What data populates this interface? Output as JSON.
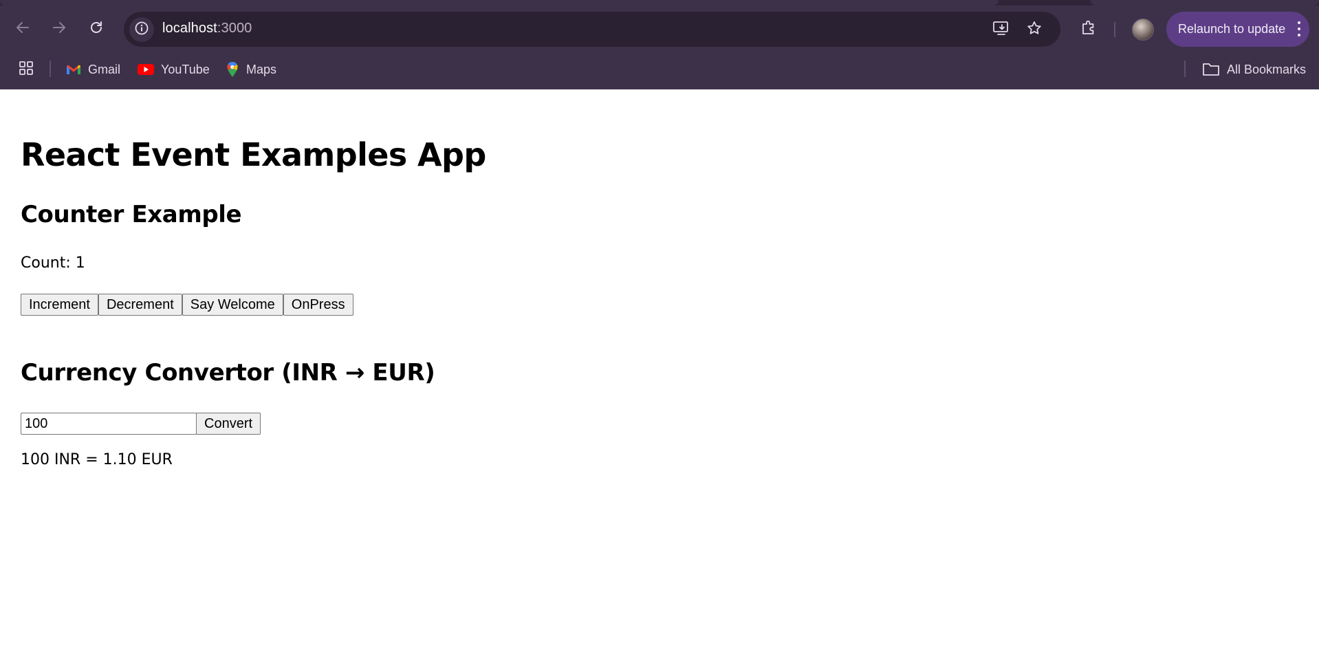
{
  "browser": {
    "url_host": "localhost",
    "url_port": ":3000",
    "relaunch_label": "Relaunch to update",
    "bookmarks": [
      {
        "label": "Gmail",
        "icon": "gmail-icon"
      },
      {
        "label": "YouTube",
        "icon": "youtube-icon"
      },
      {
        "label": "Maps",
        "icon": "maps-icon"
      }
    ],
    "all_bookmarks_label": "All Bookmarks",
    "colors": {
      "frame": "#3d3149",
      "omnibox": "#2a2132",
      "relaunch": "#5d3e86"
    }
  },
  "app": {
    "title": "React Event Examples App",
    "counter": {
      "heading": "Counter Example",
      "count_text": "Count: 1",
      "buttons": {
        "increment": "Increment",
        "decrement": "Decrement",
        "say_welcome": "Say Welcome",
        "on_press": "OnPress"
      }
    },
    "currency": {
      "heading": "Currency Convertor (INR → EUR)",
      "amount_value": "100",
      "convert_label": "Convert",
      "result_text": "100 INR = 1.10 EUR"
    }
  }
}
